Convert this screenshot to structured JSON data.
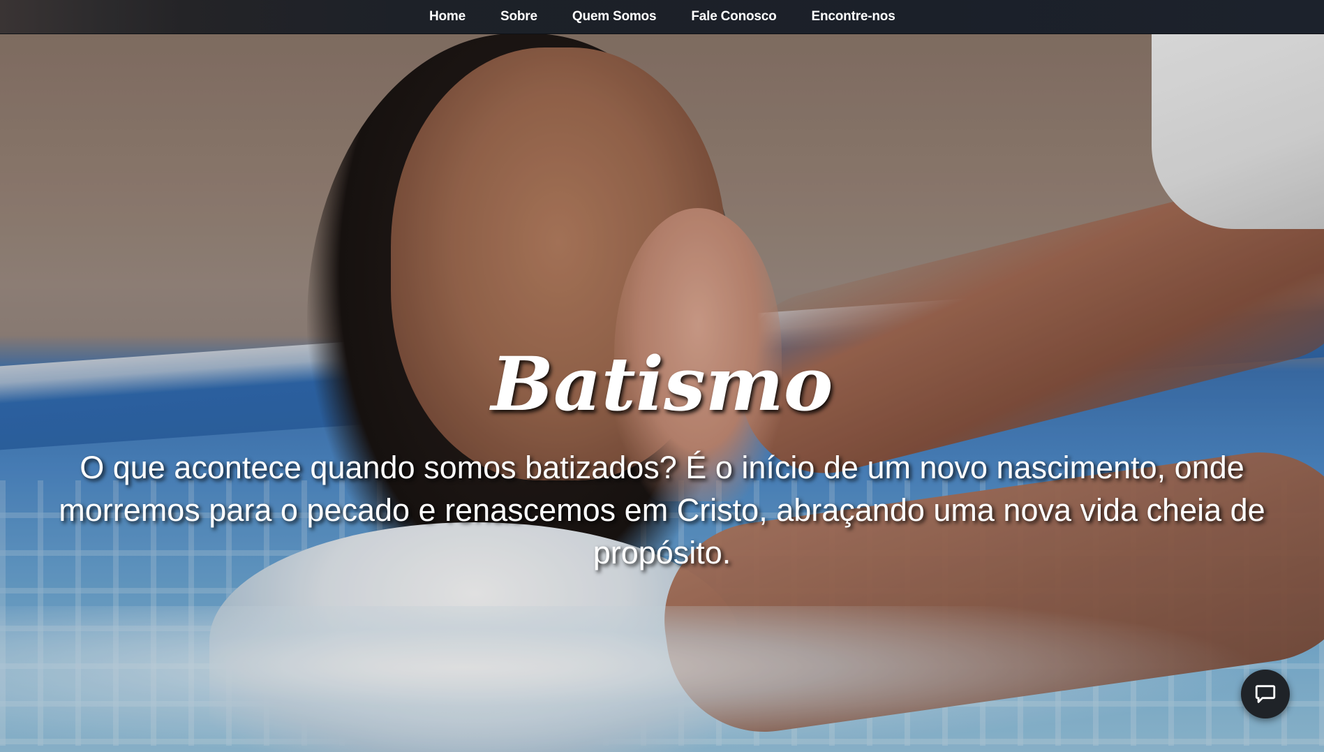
{
  "nav": {
    "items": [
      {
        "label": "Home"
      },
      {
        "label": "Sobre"
      },
      {
        "label": "Quem Somos"
      },
      {
        "label": "Fale Conosco"
      },
      {
        "label": "Encontre-nos"
      }
    ]
  },
  "hero": {
    "title": "Batismo",
    "text": "O que acontece quando somos batizados? É o início de um novo nascimento, onde morremos para o pecado e renascemos em Cristo, abraçando uma nova vida cheia de propósito.",
    "background_icon": "baptism-photo"
  },
  "chat": {
    "icon": "chat-bubble-icon"
  },
  "colors": {
    "navbar": "#1d2128",
    "text": "#ffffff",
    "chat_button": "#1f2328"
  }
}
